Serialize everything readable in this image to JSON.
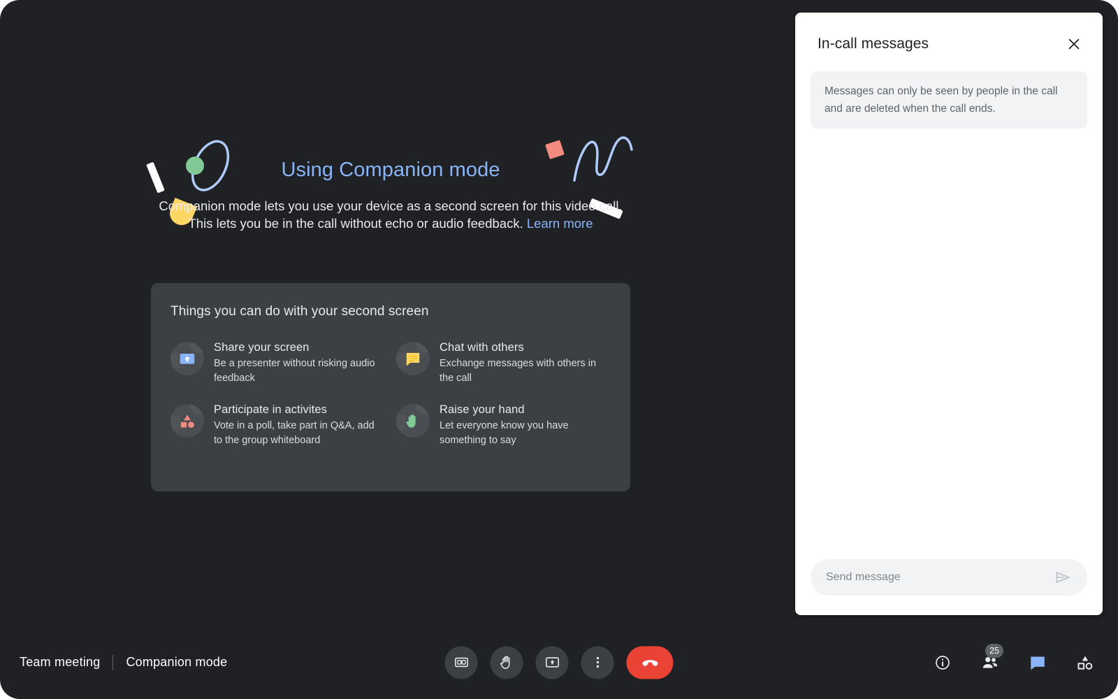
{
  "promo": {
    "title": "Using Companion mode",
    "body": "Companion mode lets you use your device as a second screen for this video call. This lets you be in the call without echo or audio feedback.",
    "learn_more": "Learn more",
    "card_title": "Things you can do with your second screen",
    "features": [
      {
        "icon": "present-screen-icon",
        "title": "Share your screen",
        "desc": "Be a presenter without risking audio feedback"
      },
      {
        "icon": "chat-bubble-icon",
        "title": "Chat with others",
        "desc": "Exchange messages with others in the call"
      },
      {
        "icon": "activities-shapes-icon",
        "title": "Participate in activites",
        "desc": "Vote in a poll, take part in Q&A, add to the group whiteboard"
      },
      {
        "icon": "raised-hand-icon",
        "title": "Raise your hand",
        "desc": "Let everyone know you have something to say"
      }
    ]
  },
  "chat_panel": {
    "title": "In-call messages",
    "close_icon": "close-icon",
    "notice": "Messages can only be seen by people in the call and are deleted when the call ends.",
    "input_placeholder": "Send message",
    "input_value": "",
    "send_icon": "send-icon"
  },
  "bottom_bar": {
    "meeting_name": "Team meeting",
    "meeting_mode": "Companion mode",
    "center_controls": [
      {
        "name": "captions-button",
        "icon": "closed-caption-icon",
        "label": "Turn on captions"
      },
      {
        "name": "raise-hand-button",
        "icon": "raised-hand-icon",
        "label": "Raise hand"
      },
      {
        "name": "present-button",
        "icon": "present-screen-icon",
        "label": "Present now"
      },
      {
        "name": "more-options-button",
        "icon": "more-vert-icon",
        "label": "More options"
      },
      {
        "name": "leave-call-button",
        "icon": "call-end-icon",
        "label": "Leave call"
      }
    ],
    "right_controls": [
      {
        "name": "meeting-details-button",
        "icon": "info-icon",
        "label": "Meeting details",
        "badge": ""
      },
      {
        "name": "participants-button",
        "icon": "people-icon",
        "label": "Show everyone",
        "badge": "25"
      },
      {
        "name": "chat-button",
        "icon": "chat-bubble-icon",
        "label": "Chat with everyone",
        "badge": "",
        "active": true
      },
      {
        "name": "activities-button",
        "icon": "activities-shapes-icon",
        "label": "Activities",
        "badge": ""
      }
    ]
  },
  "colors": {
    "background": "#202124",
    "card": "#3c4043",
    "accent_blue": "#8ab4f8",
    "hangup_red": "#ea4335",
    "panel_white": "#ffffff",
    "doodle_green": "#81c995",
    "doodle_yellow": "#fdd663",
    "doodle_red": "#f28b82"
  }
}
